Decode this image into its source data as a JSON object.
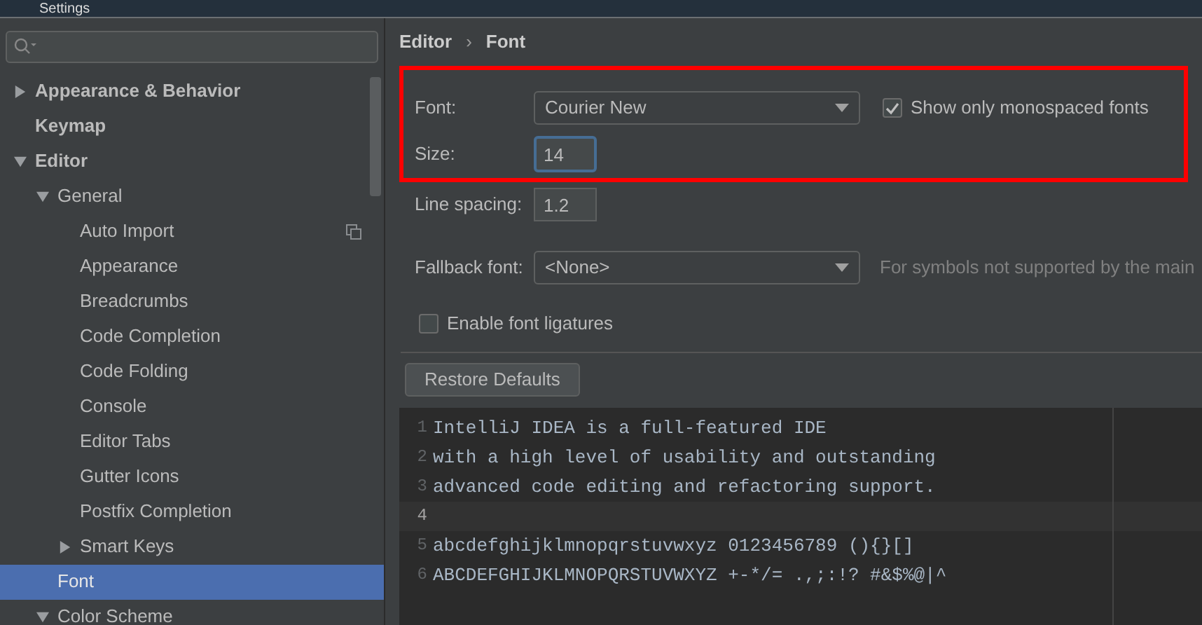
{
  "window": {
    "title": "Settings"
  },
  "tree": [
    {
      "label": "Appearance & Behavior",
      "expanded": false,
      "selected": false
    },
    {
      "label": "Keymap",
      "selected": false
    },
    {
      "label": "Editor",
      "expanded": true,
      "selected": false,
      "children": [
        {
          "label": "General",
          "expanded": true,
          "selected": false,
          "children": [
            {
              "label": "Auto Import",
              "selected": false,
              "scope_icon": true
            },
            {
              "label": "Appearance",
              "selected": false
            },
            {
              "label": "Breadcrumbs",
              "selected": false
            },
            {
              "label": "Code Completion",
              "selected": false
            },
            {
              "label": "Code Folding",
              "selected": false
            },
            {
              "label": "Console",
              "selected": false
            },
            {
              "label": "Editor Tabs",
              "selected": false
            },
            {
              "label": "Gutter Icons",
              "selected": false
            },
            {
              "label": "Postfix Completion",
              "selected": false
            },
            {
              "label": "Smart Keys",
              "expanded": false,
              "selected": false
            }
          ]
        },
        {
          "label": "Font",
          "selected": true
        },
        {
          "label": "Color Scheme",
          "expanded": true,
          "selected": false
        }
      ]
    }
  ],
  "breadcrumb": [
    "Editor",
    "Font"
  ],
  "breadcrumb_separator": "›",
  "font": {
    "label": "Font:",
    "value": "Courier New"
  },
  "monospaced": {
    "label": "Show only monospaced fonts",
    "checked": true
  },
  "size": {
    "label": "Size:",
    "value": "14"
  },
  "line_spacing": {
    "label": "Line spacing:",
    "value": "1.2"
  },
  "fallback": {
    "label": "Fallback font:",
    "value": "<None>",
    "hint": "For symbols not supported by the main"
  },
  "ligatures": {
    "label": "Enable font ligatures",
    "checked": false
  },
  "restore_button": "Restore Defaults",
  "preview": [
    {
      "number": "1",
      "text": "IntelliJ IDEA is a full-featured IDE",
      "current": false
    },
    {
      "number": "2",
      "text": "with a high level of usability and outstanding",
      "current": false
    },
    {
      "number": "3",
      "text": "advanced code editing and refactoring support.",
      "current": false
    },
    {
      "number": "4",
      "current": true
    },
    {
      "number": "5",
      "text": "abcdefghijklmnopqrstuvwxyz 0123456789 (){}[]",
      "current": false
    },
    {
      "number": "6",
      "text": "ABCDEFGHIJKLMNOPQRSTUVWXYZ +-*/= .,;:!? #&$%@|^",
      "current": false
    }
  ]
}
